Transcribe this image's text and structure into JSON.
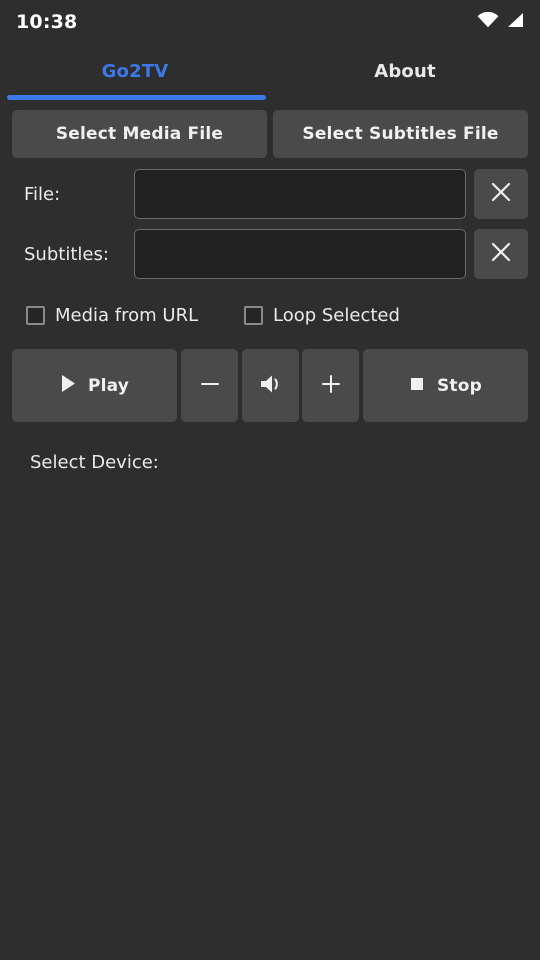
{
  "statusbar": {
    "time": "10:38",
    "icons": [
      {
        "name": "wifi-icon"
      },
      {
        "name": "cellular-signal-icon"
      }
    ]
  },
  "tabs": [
    {
      "id": "go2tv",
      "label": "Go2TV",
      "active": true
    },
    {
      "id": "about",
      "label": "About",
      "active": false
    }
  ],
  "colors": {
    "accent": "#3b78e8",
    "background": "#2e2e2e",
    "button": "#4a4a4a",
    "input_background": "#222222",
    "input_border": "#6a6a6a",
    "text": "#eaeaea"
  },
  "actions": {
    "select_media_file": "Select Media File",
    "select_subtitles_file": "Select Subtitles File"
  },
  "fields": {
    "file": {
      "label": "File:",
      "value": "",
      "placeholder": "",
      "clear_label": "✕"
    },
    "subtitles": {
      "label": "Subtitles:",
      "value": "",
      "placeholder": "",
      "clear_label": "✕"
    }
  },
  "checkboxes": [
    {
      "id": "media-from-url",
      "label": "Media from URL",
      "checked": false
    },
    {
      "id": "loop-selected",
      "label": "Loop Selected",
      "checked": false
    }
  ],
  "controls": {
    "play": {
      "label": "Play",
      "icon": "play-icon"
    },
    "volume_down": {
      "label": "",
      "icon": "minus-icon"
    },
    "volume": {
      "label": "",
      "icon": "volume-icon"
    },
    "volume_up": {
      "label": "",
      "icon": "plus-icon"
    },
    "stop": {
      "label": "Stop",
      "icon": "stop-icon"
    }
  },
  "device": {
    "label": "Select Device:",
    "items": []
  }
}
